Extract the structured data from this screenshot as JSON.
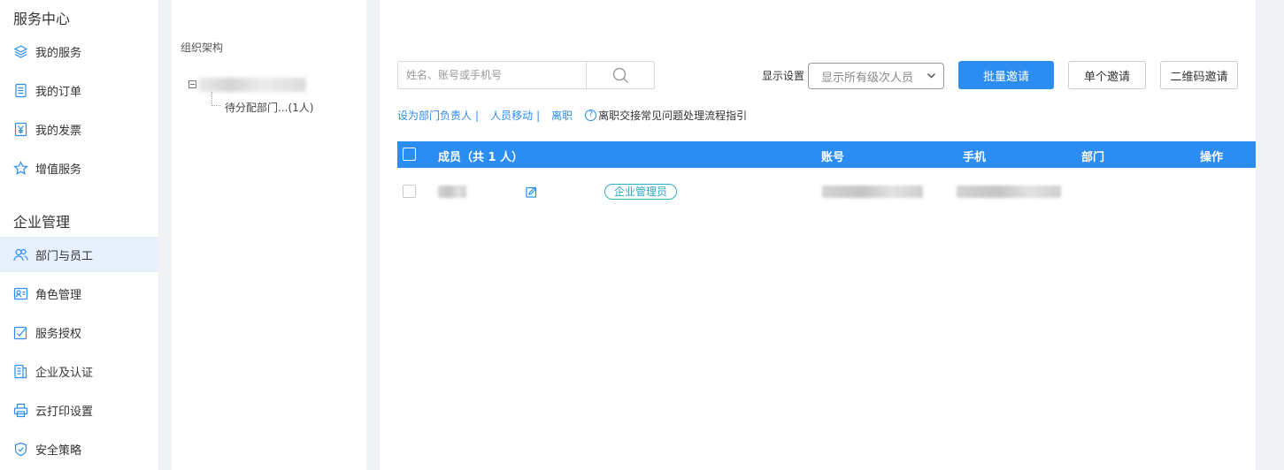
{
  "sidebar": {
    "service_center_title": "服务中心",
    "service_items": [
      {
        "label": "我的服务",
        "icon": "layers-icon"
      },
      {
        "label": "我的订单",
        "icon": "document-icon"
      },
      {
        "label": "我的发票",
        "icon": "invoice-icon"
      },
      {
        "label": "增值服务",
        "icon": "star-icon"
      }
    ],
    "enterprise_title": "企业管理",
    "enterprise_items": [
      {
        "label": "部门与员工",
        "icon": "users-icon",
        "active": true
      },
      {
        "label": "角色管理",
        "icon": "id-card-icon"
      },
      {
        "label": "服务授权",
        "icon": "authorize-icon"
      },
      {
        "label": "企业及认证",
        "icon": "certificate-icon"
      },
      {
        "label": "云打印设置",
        "icon": "printer-icon"
      },
      {
        "label": "安全策略",
        "icon": "shield-icon"
      }
    ]
  },
  "org": {
    "title": "组织架构",
    "toggle": "−",
    "child_label": "待分配部门...(1人)"
  },
  "toolbar": {
    "search_placeholder": "姓名、账号或手机号",
    "display_label": "显示设置",
    "display_value": "显示所有级次人员",
    "batch_invite": "批量邀请",
    "single_invite": "单个邀请",
    "qr_invite": "二维码邀请"
  },
  "actions": {
    "set_head": "设为部门负责人",
    "move": "人员移动",
    "leave": "离职",
    "sep": "|",
    "help_text": "离职交接常见问题处理流程指引"
  },
  "table": {
    "columns": {
      "member": "成员（共 1 人）",
      "account": "账号",
      "phone": "手机",
      "dept": "部门",
      "ops": "操作"
    },
    "rows": [
      {
        "role_badge": "企业管理员"
      }
    ]
  },
  "colors": {
    "primary": "#2b8cf2",
    "sidebar_active_bg": "#e6f1fc",
    "badge": "#2ab0c5"
  }
}
